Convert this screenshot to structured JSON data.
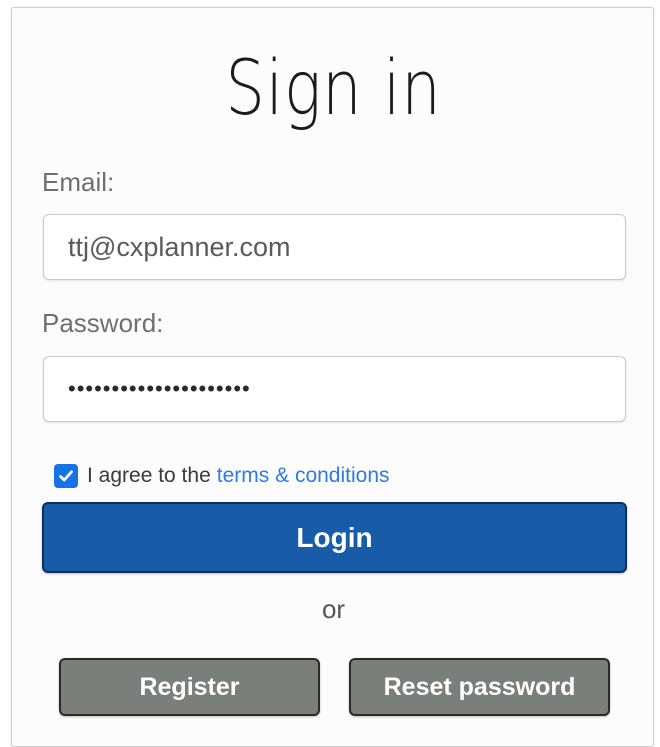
{
  "form": {
    "title": "Sign in",
    "email": {
      "label": "Email:",
      "value": "ttj@cxplanner.com"
    },
    "password": {
      "label": "Password:",
      "masked_value": "•••••••••••••••••••••"
    },
    "agreement": {
      "checked": true,
      "text": "I agree to the",
      "link_text": "terms & conditions"
    },
    "login_label": "Login",
    "or_text": "or",
    "register_label": "Register",
    "reset_label": "Reset password"
  },
  "colors": {
    "primary_button": "#175ba9",
    "secondary_button": "#7b7f7b",
    "link": "#2d7be5",
    "checkbox": "#1473e6"
  },
  "icons": {
    "checkbox": "checkmark-icon"
  }
}
